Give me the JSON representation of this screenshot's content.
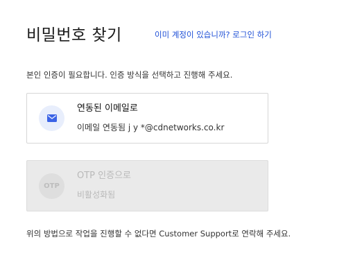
{
  "header": {
    "title": "비밀번호 찾기",
    "login_link": "이미 계정이 있습니까? 로그인 하기"
  },
  "description": "본인 인증이 필요합니다. 인증 방식을 선택하고 진행해 주세요.",
  "options": {
    "email": {
      "title": "연동된 이메일로",
      "subtitle": "이메일 연동됨  j  y        *@cdnetworks.co.kr",
      "icon": "envelope-icon",
      "icon_color": "#3b63e6",
      "enabled": true
    },
    "otp": {
      "badge_text": "OTP",
      "title": "OTP 인증으로",
      "subtitle": "비활성화됨",
      "enabled": false
    }
  },
  "footer": "위의 방법으로 작업을 진행할 수 없다면 Customer Support로 연락해 주세요.",
  "colors": {
    "link": "#1e4fd6",
    "disabled_bg": "#eaeaea",
    "disabled_text": "#b9b9b9"
  }
}
